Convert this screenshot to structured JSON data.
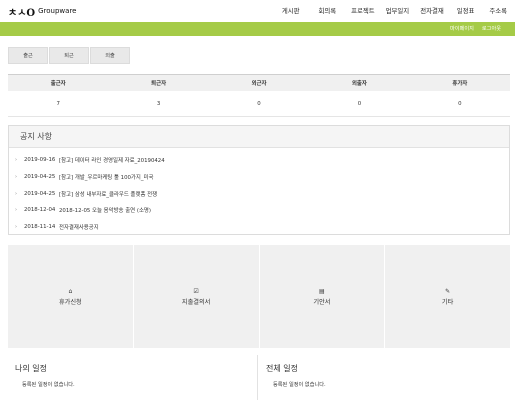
{
  "header": {
    "logo_mark": "ㅊㅅO",
    "logo_name": "Groupware",
    "nav": [
      "게시판",
      "회의록",
      "프로젝트",
      "업무일지",
      "전자결재",
      "일정표",
      "주소록"
    ]
  },
  "subbar": {
    "links": [
      "마이페이지",
      "로그아웃"
    ],
    "color": "#a5cb47"
  },
  "attendance_buttons": [
    "출근",
    "퇴근",
    "외출"
  ],
  "stats": {
    "headers": [
      "출근자",
      "퇴근자",
      "외근자",
      "외출자",
      "휴가자"
    ],
    "values": [
      "7",
      "3",
      "0",
      "0",
      "0"
    ]
  },
  "notice": {
    "title": "공지 사항",
    "items": [
      {
        "date": "2019-09-16",
        "text": "[참고] 데이터 라인 경영일제 자료_20190424"
      },
      {
        "date": "2019-04-25",
        "text": "[참고] 개발_우르마케팅 툴 100가지_미국"
      },
      {
        "date": "2019-04-25",
        "text": "[참고] 삼성 내부자료_클라우드 플랫폼 전쟁"
      },
      {
        "date": "2018-12-04",
        "text": "2018-12-05 오늘 음악방송 출연 (소명)"
      },
      {
        "date": "2018-11-14",
        "text": "전자결재사용공지"
      }
    ]
  },
  "tiles": [
    {
      "icon": "home-icon",
      "glyph": "⌂",
      "label": "휴가신청"
    },
    {
      "icon": "expense-icon",
      "glyph": "☑",
      "label": "지출결의서"
    },
    {
      "icon": "document-icon",
      "glyph": "▤",
      "label": "기안서"
    },
    {
      "icon": "misc-icon",
      "glyph": "✎",
      "label": "기타"
    }
  ],
  "my_schedule": {
    "title": "나의 일정",
    "empty": "등록된 일정이 없습니다."
  },
  "all_schedule": {
    "title": "전체 일정",
    "empty": "등록된 일정이 없습니다."
  }
}
